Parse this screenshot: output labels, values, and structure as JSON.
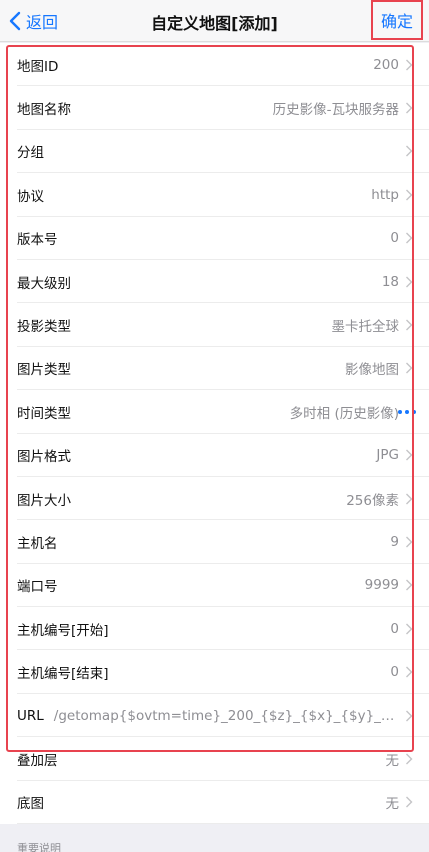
{
  "nav": {
    "back_label": "返回",
    "title": "自定义地图[添加]",
    "confirm_label": "确定"
  },
  "rows": [
    {
      "label": "地图ID",
      "value": "200"
    },
    {
      "label": "地图名称",
      "value": "历史影像-瓦块服务器"
    },
    {
      "label": "分组",
      "value": ""
    },
    {
      "label": "协议",
      "value": "http"
    },
    {
      "label": "版本号",
      "value": "0"
    },
    {
      "label": "最大级别",
      "value": "18"
    },
    {
      "label": "投影类型",
      "value": "墨卡托全球"
    },
    {
      "label": "图片类型",
      "value": "影像地图"
    },
    {
      "label": "时间类型",
      "value": "多时相 (历史影像)"
    },
    {
      "label": "图片格式",
      "value": "JPG"
    },
    {
      "label": "图片大小",
      "value": "256像素"
    },
    {
      "label": "主机名",
      "value": "9"
    },
    {
      "label": "端口号",
      "value": "9999"
    },
    {
      "label": "主机编号[开始]",
      "value": "0"
    },
    {
      "label": "主机编号[结束]",
      "value": "0"
    },
    {
      "label": "URL",
      "value": "/getomap{$ovtm=time}_200_{$z}_{$x}_{$y}_0_{$..."
    },
    {
      "label": "叠加层",
      "value": "无"
    },
    {
      "label": "底图",
      "value": "无"
    }
  ],
  "section_note": "重要说明",
  "colors": {
    "accent": "#1677ff",
    "highlight_border": "#e8434f"
  }
}
